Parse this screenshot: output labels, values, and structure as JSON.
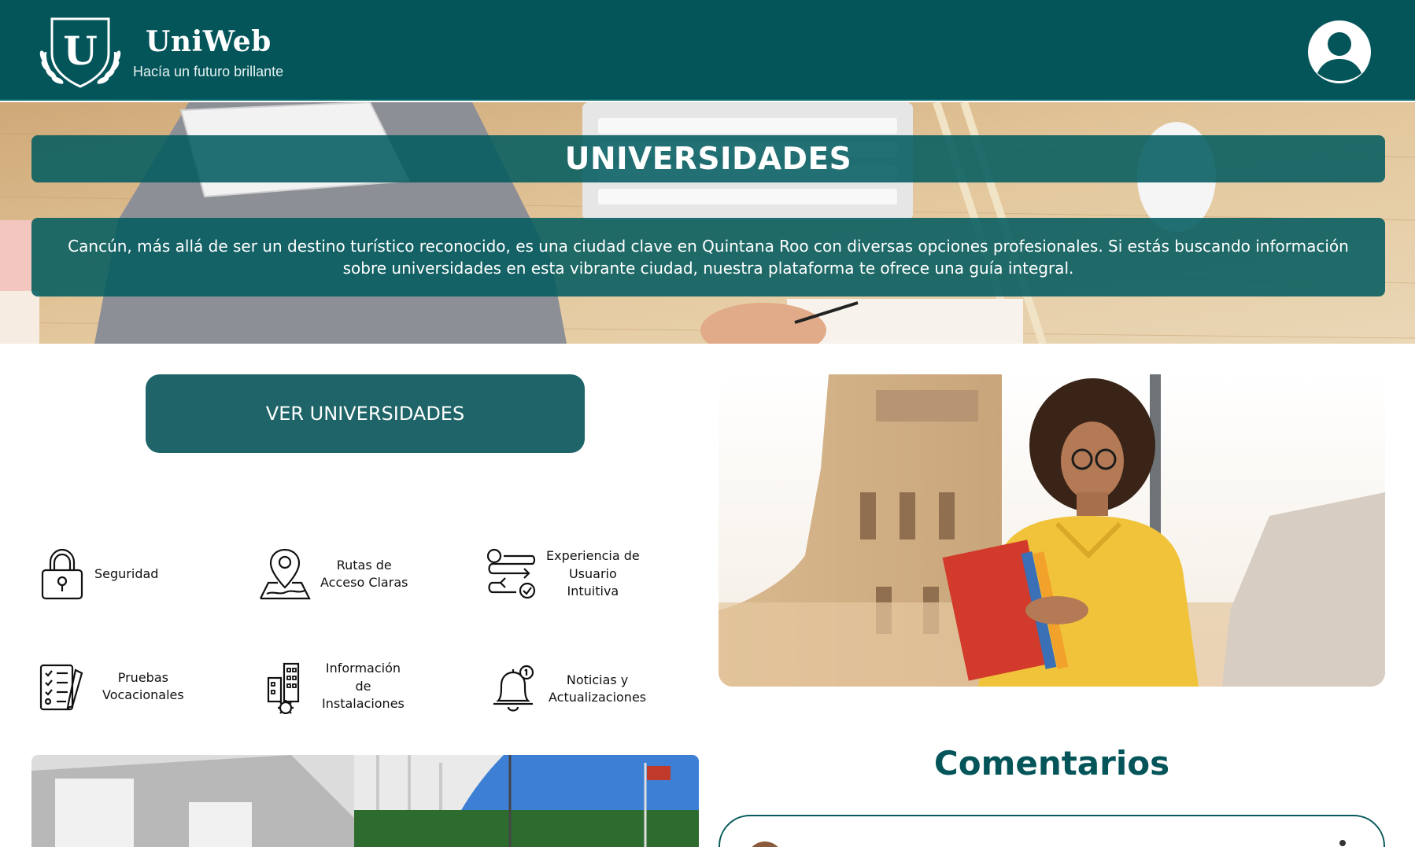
{
  "header": {
    "logo_letter": "U",
    "brand_name": "UniWeb",
    "tagline": "Hacía un futuro brillante",
    "profile_icon": "user-avatar-icon"
  },
  "hero": {
    "title": "UNIVERSIDADES",
    "description": "Cancún, más allá de ser un destino turístico reconocido, es una ciudad clave en Quintana Roo con diversas opciones profesionales. Si estás buscando información sobre universidades en esta vibrante ciudad, nuestra plataforma te ofrece una guía integral."
  },
  "cta": {
    "label": "VER UNIVERSIDADES"
  },
  "features": [
    {
      "icon": "padlock-icon",
      "lines": [
        "Seguridad"
      ]
    },
    {
      "icon": "map-pin-route-icon",
      "lines": [
        "Rutas de",
        "Acceso Claras"
      ]
    },
    {
      "icon": "user-flow-icon",
      "lines": [
        "Experiencia de",
        "Usuario",
        "Intuitiva"
      ]
    },
    {
      "icon": "checklist-test-icon",
      "lines": [
        "Pruebas",
        "Vocacionales"
      ]
    },
    {
      "icon": "building-gear-icon",
      "lines": [
        "Información",
        "de",
        "Instalaciones"
      ]
    },
    {
      "icon": "notification-bell-icon",
      "lines": [
        "Noticias y",
        "Actualizaciones"
      ]
    }
  ],
  "comments": {
    "title": "Comentarios"
  },
  "colors": {
    "primary": "#03555a",
    "button": "#1f6468",
    "overlay": "#035c60",
    "text_dark": "#111111"
  }
}
